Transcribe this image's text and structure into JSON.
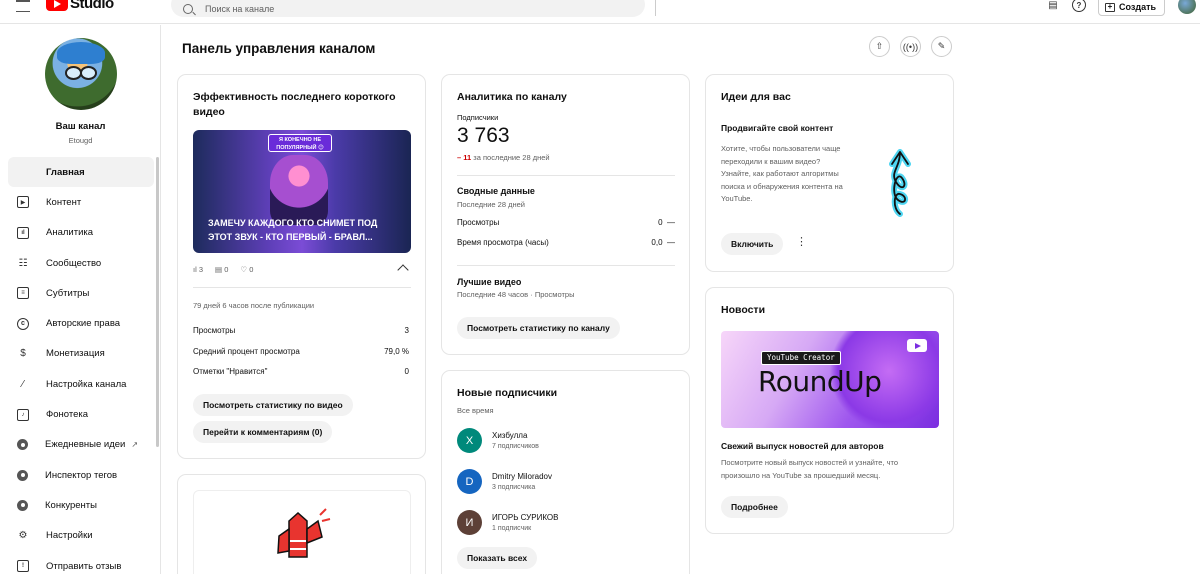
{
  "header": {
    "logo_text": "Studio",
    "search_placeholder": "Поиск на канале",
    "create_label": "Создать"
  },
  "sidebar": {
    "channel_name": "Ваш канал",
    "channel_handle": "Etougd",
    "items": [
      {
        "label": "Главная",
        "icon": "dashboard-icon",
        "active": true
      },
      {
        "label": "Контент",
        "icon": "content-icon"
      },
      {
        "label": "Аналитика",
        "icon": "analytics-icon"
      },
      {
        "label": "Сообщество",
        "icon": "community-icon"
      },
      {
        "label": "Субтитры",
        "icon": "subtitles-icon"
      },
      {
        "label": "Авторские права",
        "icon": "copyright-icon"
      },
      {
        "label": "Монетизация",
        "icon": "dollar-icon"
      },
      {
        "label": "Настройка канала",
        "icon": "magic-wand-icon"
      },
      {
        "label": "Фонотека",
        "icon": "audio-library-icon"
      },
      {
        "label": "Ежедневные идеи",
        "icon": "extension-icon",
        "external": true
      },
      {
        "label": "Инспектор тегов",
        "icon": "extension-icon"
      },
      {
        "label": "Конкуренты",
        "icon": "extension-icon"
      },
      {
        "label": "Настройки",
        "icon": "gear-icon"
      },
      {
        "label": "Отправить отзыв",
        "icon": "feedback-icon"
      }
    ]
  },
  "page": {
    "title": "Панель управления каналом"
  },
  "short_card": {
    "title": "Эффективность последнего короткого видео",
    "thumb_sticker": "Я КОНЕЧНО НЕ ПОПУЛЯРНЫЙ 😊",
    "thumb_caption": "ЗАМЕЧУ КАЖДОГО КТО СНИМЕТ ПОД ЭТОТ ЗВУК - КТО ПЕРВЫЙ - БРАВЛ...",
    "views_count": "3",
    "comments_count": "0",
    "likes_count": "0",
    "age": "79 дней 6 часов после публикации",
    "rows": [
      {
        "label": "Просмотры",
        "value": "3"
      },
      {
        "label": "Средний процент просмотра",
        "value": "79,0 %"
      },
      {
        "label": "Отметки \"Нравится\"",
        "value": "0"
      }
    ],
    "stats_button": "Посмотреть статистику по видео",
    "comments_button": "Перейти к комментариям (0)"
  },
  "analytics_card": {
    "title": "Аналитика по каналу",
    "subscribers_label": "Подписчики",
    "subscribers_value": "3 763",
    "change_value": "– 11",
    "change_period": "за последние 28 дней",
    "summary_title": "Сводные данные",
    "summary_period": "Последние 28 дней",
    "rows": [
      {
        "label": "Просмотры",
        "value": "0",
        "trend": "—"
      },
      {
        "label": "Время просмотра (часы)",
        "value": "0,0",
        "trend": "—"
      }
    ],
    "top_title": "Лучшие видео",
    "top_period": "Последние 48 часов · Просмотры",
    "button": "Посмотреть статистику по каналу"
  },
  "subscribers_card": {
    "title": "Новые подписчики",
    "period": "Все время",
    "items": [
      {
        "initial": "X",
        "name": "Хизбулла",
        "count": "7 подписчиков",
        "color": "#00897b"
      },
      {
        "initial": "D",
        "name": "Dmitry Miloradov",
        "count": "3 подписчика",
        "color": "#1565c0"
      },
      {
        "initial": "И",
        "name": "ИГОРЬ СУРИКОВ",
        "count": "1 подписчик",
        "color": "#5d4037"
      }
    ],
    "button": "Показать всех"
  },
  "ideas_card": {
    "title": "Идеи для вас",
    "subtitle": "Продвигайте свой контент",
    "text": "Хотите, чтобы пользователи чаще переходили к вашим видео? Узнайте, как работают алгоритмы поиска и обнаружения контента на YouTube.",
    "button": "Включить"
  },
  "news_card": {
    "title": "Новости",
    "banner_tag": "YouTube Creator",
    "banner_title": "RoundUp",
    "headline": "Свежий выпуск новостей для авторов",
    "text": "Посмотрите новый выпуск новостей и узнайте, что произошло на YouTube за прошедший месяц.",
    "button": "Подробнее"
  },
  "colors": {
    "accent_red": "#ff0000",
    "negative": "#cc0000",
    "muted": "#606060"
  }
}
